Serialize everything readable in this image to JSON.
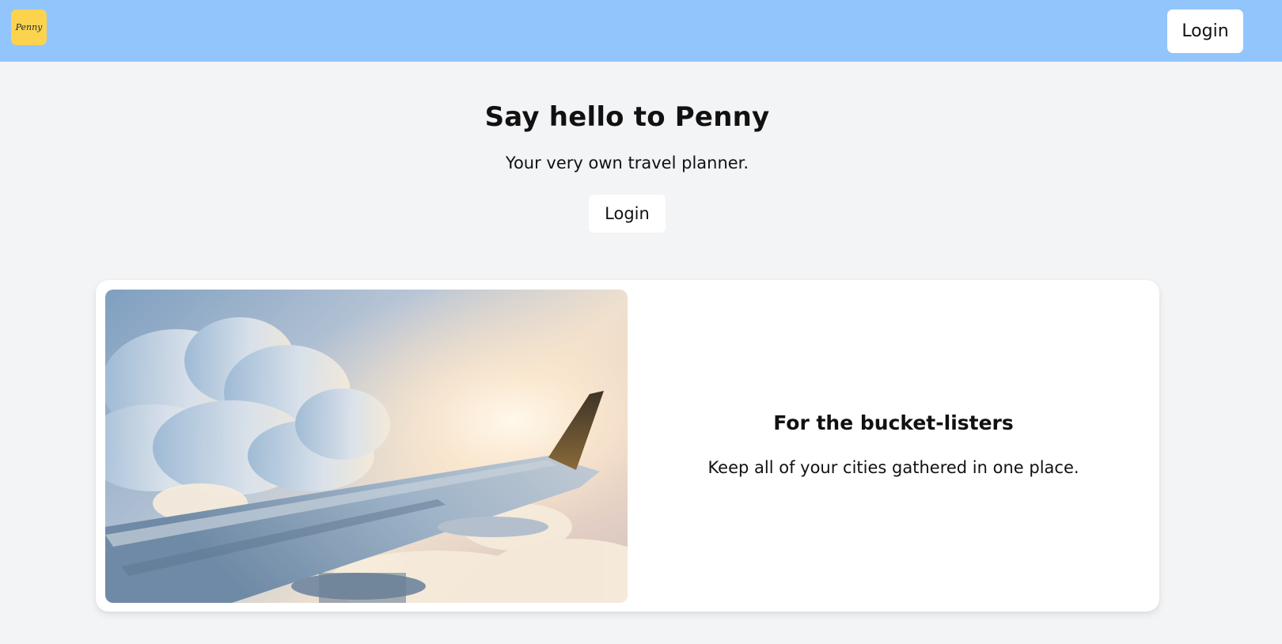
{
  "navbar": {
    "logo_text": "Penny",
    "login_label": "Login",
    "background": "#93c5fd",
    "logo_color": "#fcd34d"
  },
  "hero": {
    "title": "Say hello to Penny",
    "subtitle": "Your very own travel planner.",
    "login_label": "Login"
  },
  "feature": {
    "image_icon": "airplane-wing-photo",
    "title": "For the bucket-listers",
    "description": "Keep all of your cities gathered in one place."
  },
  "colors": {
    "page_background": "#f3f4f6",
    "card_background": "#ffffff"
  }
}
